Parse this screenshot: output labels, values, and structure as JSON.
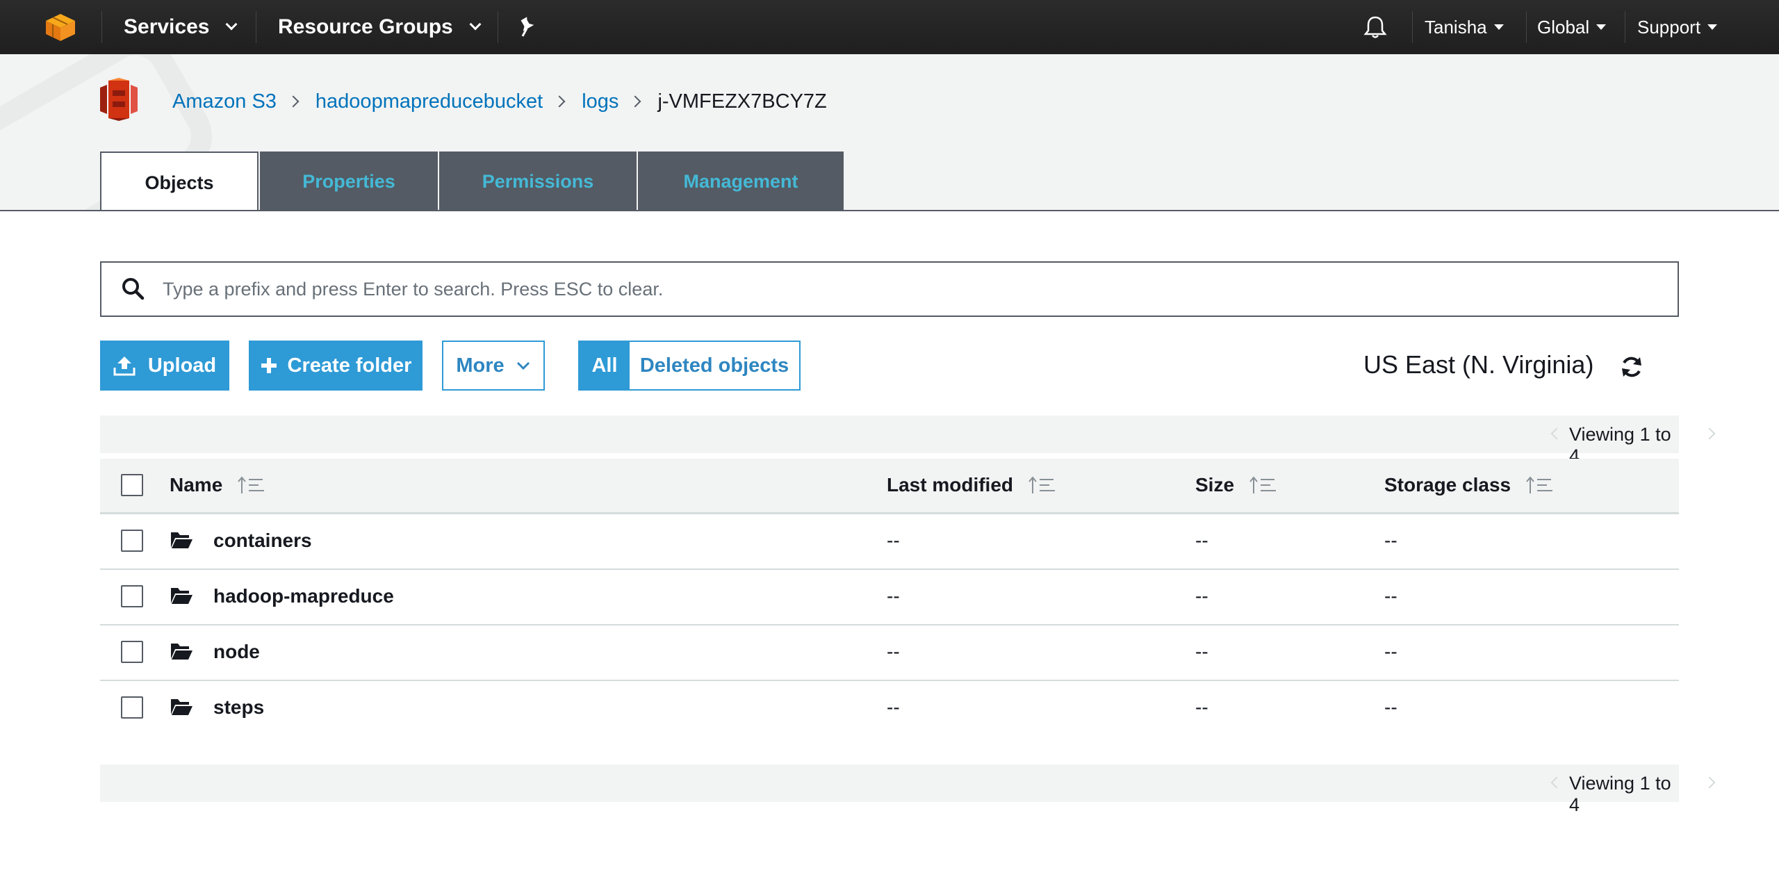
{
  "topnav": {
    "services": "Services",
    "resource_groups": "Resource Groups",
    "user": "Tanisha",
    "region": "Global",
    "support": "Support"
  },
  "breadcrumb": [
    "Amazon S3",
    "hadoopmapreducebucket",
    "logs",
    "j-VMFEZX7BCY7Z"
  ],
  "tabs": [
    "Objects",
    "Properties",
    "Permissions",
    "Management"
  ],
  "search": {
    "placeholder": "Type a prefix and press Enter to search. Press ESC to clear."
  },
  "actions": {
    "upload": "Upload",
    "create_folder": "Create folder",
    "more": "More",
    "all": "All",
    "deleted_objects": "Deleted objects"
  },
  "region_label": "US East (N. Virginia)",
  "viewing": "Viewing 1 to 4",
  "table": {
    "columns": [
      "Name",
      "Last modified",
      "Size",
      "Storage class"
    ],
    "rows": [
      {
        "name": "containers",
        "last_modified": "--",
        "size": "--",
        "storage_class": "--"
      },
      {
        "name": "hadoop-mapreduce",
        "last_modified": "--",
        "size": "--",
        "storage_class": "--"
      },
      {
        "name": "node",
        "last_modified": "--",
        "size": "--",
        "storage_class": "--"
      },
      {
        "name": "steps",
        "last_modified": "--",
        "size": "--",
        "storage_class": "--"
      }
    ]
  },
  "colors": {
    "nav_bg": "#232f3e",
    "accent": "#2e9ad6",
    "link": "#0073bb",
    "tab_bg": "#545b64",
    "tab_text": "#44b9d6",
    "aws_orange": "#ff9900",
    "s3_red": "#d13212"
  }
}
